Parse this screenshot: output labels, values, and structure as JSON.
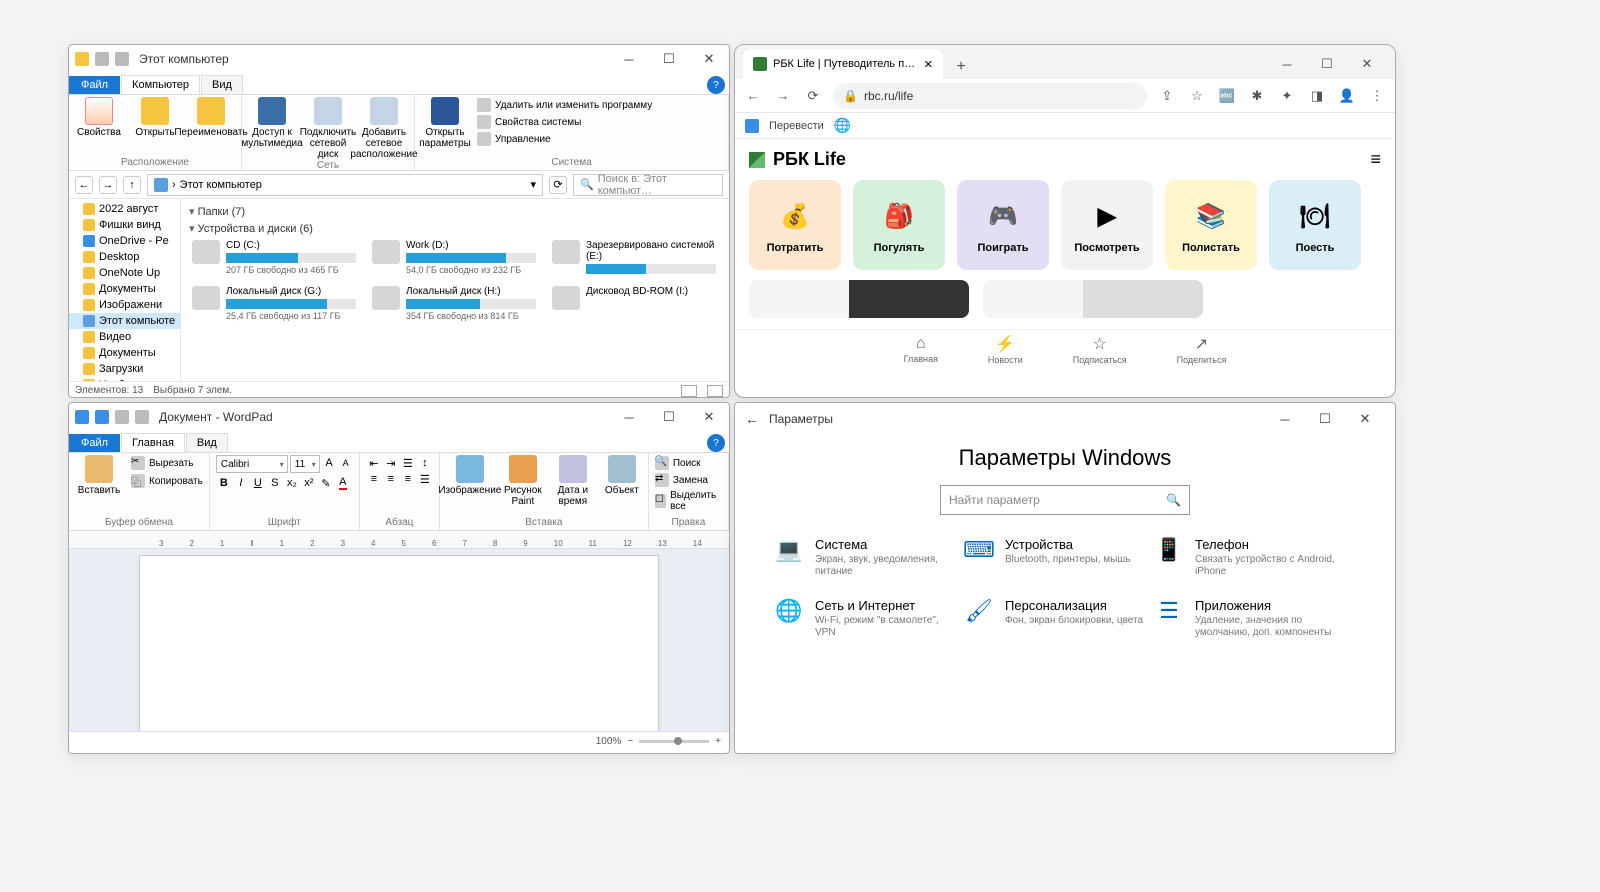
{
  "explorer": {
    "title": "Этот компьютер",
    "tabs": {
      "file": "Файл",
      "computer": "Компьютер",
      "view": "Вид"
    },
    "ribbon": {
      "location": {
        "label": "Расположение",
        "props": "Свойства",
        "open": "Открыть",
        "rename": "Переименовать"
      },
      "network": {
        "label": "Сеть",
        "media": "Доступ к мультимедиа",
        "netdrive": "Подключить сетевой диск",
        "addloc": "Добавить сетевое расположение"
      },
      "system": {
        "label": "Система",
        "openparams": "Открыть параметры",
        "uninstall": "Удалить или изменить программу",
        "sysprops": "Свойства системы",
        "manage": "Управление"
      }
    },
    "breadcrumb": "Этот компьютер",
    "search_placeholder": "Поиск в: Этот компьют…",
    "tree": [
      "2022 август",
      "Фишки винд",
      "OneDrive - Pe",
      "Desktop",
      "OneNote Up",
      "Документы",
      "Изображени",
      "Этот компьюте",
      "Видео",
      "Документы",
      "Загрузки",
      "Изображени"
    ],
    "tree_selected": 7,
    "folders_hdr": "Папки (7)",
    "drives_hdr": "Устройства и диски (6)",
    "drives": [
      {
        "name": "CD (C:)",
        "free": "207 ГБ свободно из 465 ГБ",
        "pct": 55
      },
      {
        "name": "Work (D:)",
        "free": "54,0 ГБ свободно из 232 ГБ",
        "pct": 77
      },
      {
        "name": "Зарезервировано системой (E:)",
        "free": "",
        "pct": 46
      },
      {
        "name": "Локальный диск (G:)",
        "free": "25,4 ГБ свободно из 117 ГБ",
        "pct": 78
      },
      {
        "name": "Локальный диск (H:)",
        "free": "354 ГБ свободно из 814 ГБ",
        "pct": 57
      },
      {
        "name": "Дисковод BD-ROM (I:)",
        "free": "",
        "pct": 0
      }
    ],
    "status": {
      "count": "Элементов: 13",
      "selected": "Выбрано 7 элем."
    }
  },
  "wordpad": {
    "title": "Документ - WordPad",
    "tabs": {
      "file": "Файл",
      "home": "Главная",
      "view": "Вид"
    },
    "clipboard": {
      "label": "Буфер обмена",
      "paste": "Вставить",
      "cut": "Вырезать",
      "copy": "Копировать"
    },
    "font": {
      "label": "Шрифт",
      "name": "Calibri",
      "size": "11"
    },
    "paragraph": {
      "label": "Абзац"
    },
    "insert": {
      "label": "Вставка",
      "image": "Изображение",
      "paint": "Рисунок Paint",
      "datetime": "Дата и время",
      "object": "Объект"
    },
    "editing": {
      "label": "Правка",
      "find": "Поиск",
      "replace": "Замена",
      "selectall": "Выделить все"
    },
    "zoom": "100%"
  },
  "browser": {
    "tab_title": "РБК Life | Путеводитель по своб",
    "url": "rbc.ru/life",
    "translate": "Перевести",
    "site_name": "РБК Life",
    "tiles": [
      {
        "label": "Потратить",
        "bg": "#fde8cf"
      },
      {
        "label": "Погулять",
        "bg": "#d5f0db"
      },
      {
        "label": "Поиграть",
        "bg": "#e3def5"
      },
      {
        "label": "Посмотреть",
        "bg": "#f2f2f2"
      },
      {
        "label": "Полистать",
        "bg": "#fff6cc"
      },
      {
        "label": "Поесть",
        "bg": "#d9eef7"
      }
    ],
    "bottomnav": [
      {
        "label": "Главная"
      },
      {
        "label": "Новости"
      },
      {
        "label": "Подписаться"
      },
      {
        "label": "Поделиться"
      }
    ]
  },
  "settings": {
    "header": "Параметры",
    "title": "Параметры Windows",
    "search_placeholder": "Найти параметр",
    "cats": [
      {
        "title": "Система",
        "sub": "Экран, звук, уведомления, питание"
      },
      {
        "title": "Устройства",
        "sub": "Bluetooth, принтеры, мышь"
      },
      {
        "title": "Телефон",
        "sub": "Связать устройство с Android, iPhone"
      },
      {
        "title": "Сеть и Интернет",
        "sub": "Wi-Fi, режим \"в самолете\", VPN"
      },
      {
        "title": "Персонализация",
        "sub": "Фон, экран блокировки, цвета"
      },
      {
        "title": "Приложения",
        "sub": "Удаление, значения по умолчанию, доп. компоненты"
      }
    ]
  }
}
